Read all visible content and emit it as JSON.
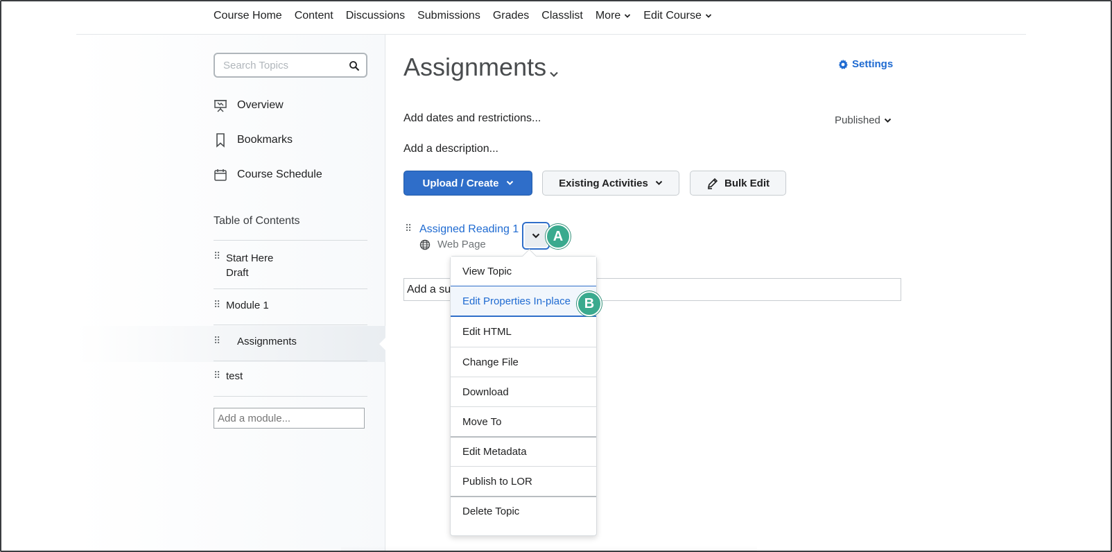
{
  "topnav": {
    "items": [
      {
        "label": "Course Home"
      },
      {
        "label": "Content"
      },
      {
        "label": "Discussions"
      },
      {
        "label": "Submissions"
      },
      {
        "label": "Grades"
      },
      {
        "label": "Classlist"
      },
      {
        "label": "More"
      },
      {
        "label": "Edit Course"
      }
    ]
  },
  "sidebar": {
    "search_placeholder": "Search Topics",
    "links": [
      {
        "label": "Overview",
        "icon": "presentation-icon"
      },
      {
        "label": "Bookmarks",
        "icon": "bookmark-icon"
      },
      {
        "label": "Course Schedule",
        "icon": "calendar-icon"
      }
    ],
    "toc_title": "Table of Contents",
    "toc": [
      {
        "label": "Start Here",
        "sub": "Draft"
      },
      {
        "label": "Module 1"
      },
      {
        "label": "Assignments"
      },
      {
        "label": "test"
      }
    ],
    "add_module_placeholder": "Add a module..."
  },
  "main": {
    "title": "Assignments",
    "settings_label": "Settings",
    "add_dates": "Add dates and restrictions...",
    "published": "Published",
    "add_description": "Add a description...",
    "buttons": {
      "upload": "Upload / Create",
      "existing": "Existing Activities",
      "bulk_edit": "Bulk Edit"
    },
    "topic": {
      "title": "Assigned Reading 1",
      "type": "Web Page"
    },
    "add_sub_value": "Add a su"
  },
  "menu": {
    "items": [
      "View Topic",
      "Edit Properties In-place",
      "Edit HTML",
      "Change File",
      "Download",
      "Move To",
      "Edit Metadata",
      "Publish to LOR",
      "Delete Topic"
    ]
  },
  "badges": {
    "a": "A",
    "b": "B"
  },
  "colors": {
    "accent": "#1e6ad1",
    "primary_button": "#2f6ec9",
    "badge": "#3aaa8e"
  }
}
